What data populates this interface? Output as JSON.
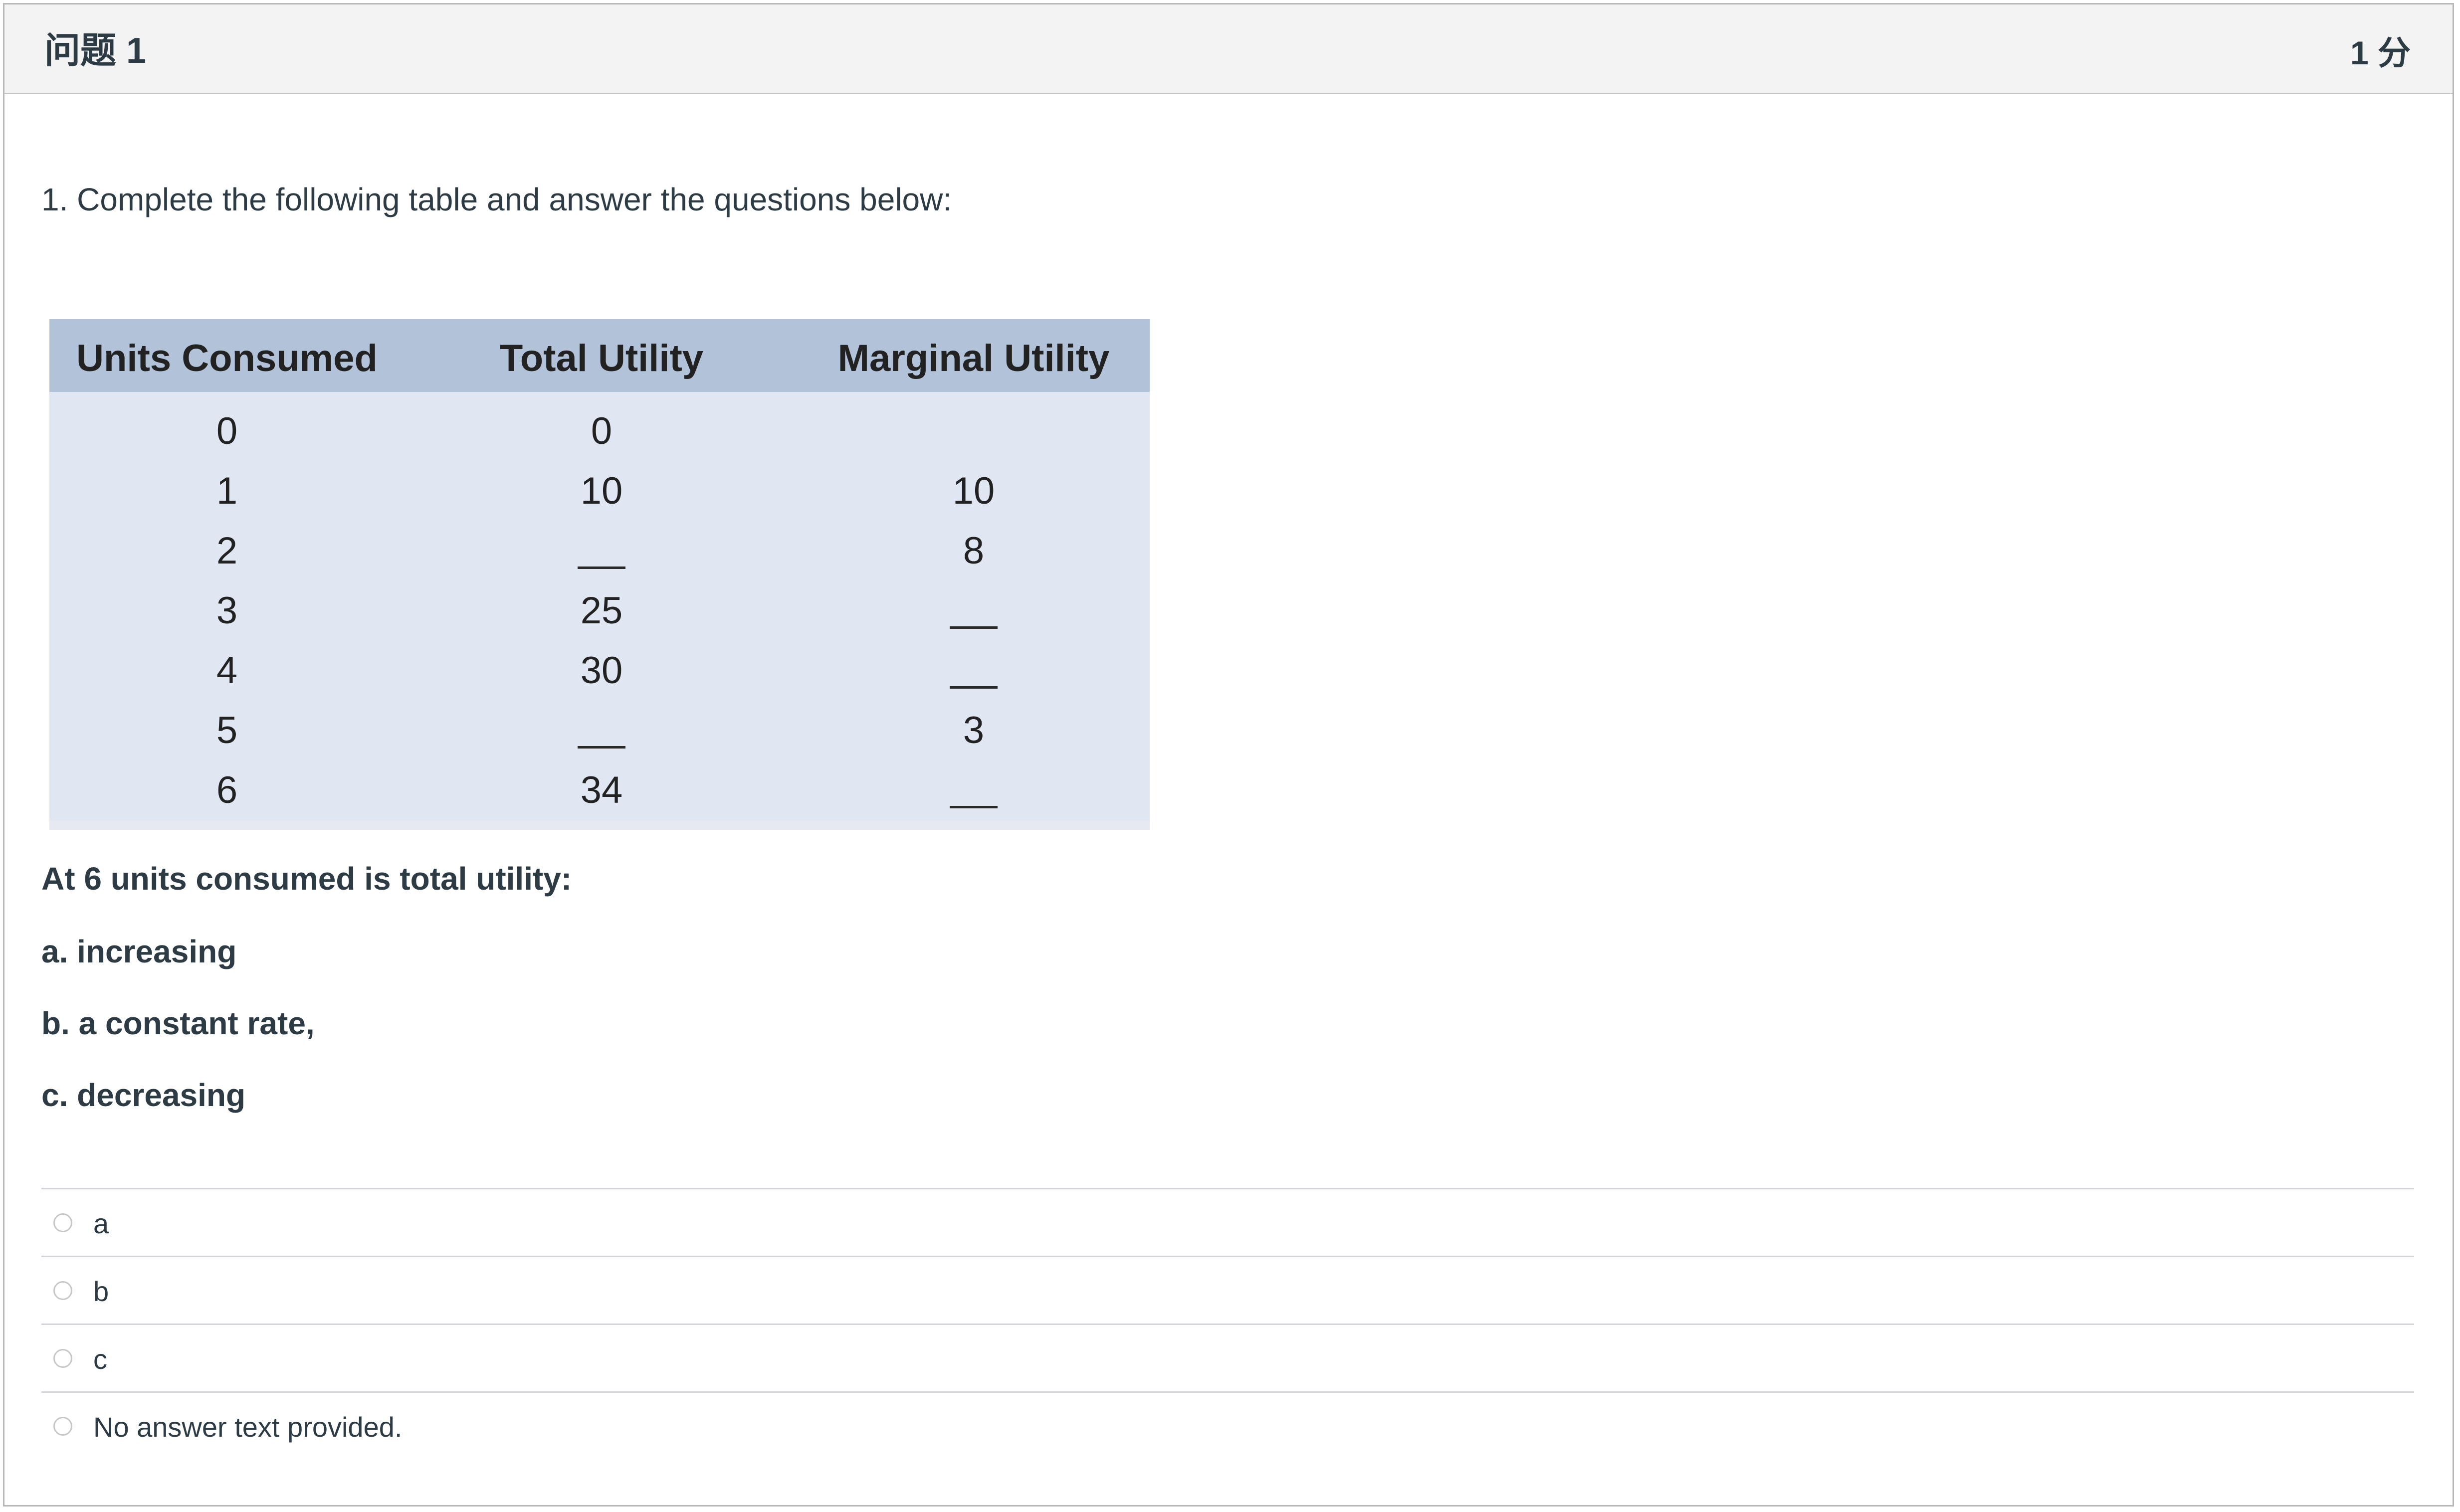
{
  "question": {
    "title": "问题 1",
    "points": "1 分",
    "prompt": "1. Complete the following table and answer the questions below:"
  },
  "utility_table": {
    "headers": [
      "Units Consumed",
      "Total Utility",
      "Marginal Utility"
    ],
    "rows": [
      {
        "units": "0",
        "total": "0",
        "marginal": ""
      },
      {
        "units": "1",
        "total": "10",
        "marginal": "10"
      },
      {
        "units": "2",
        "total": "__",
        "marginal": "8"
      },
      {
        "units": "3",
        "total": "25",
        "marginal": "__"
      },
      {
        "units": "4",
        "total": "30",
        "marginal": "__"
      },
      {
        "units": "5",
        "total": "__",
        "marginal": "3"
      },
      {
        "units": "6",
        "total": "34",
        "marginal": "__"
      }
    ]
  },
  "stem": {
    "question": "At 6 units consumed is total utility:",
    "option_a": "a. increasing",
    "option_b": "b.  a constant rate,",
    "option_c": "c. decreasing"
  },
  "answers": [
    {
      "label": "a",
      "selected": false
    },
    {
      "label": "b",
      "selected": false
    },
    {
      "label": "c",
      "selected": false
    },
    {
      "label": "No answer text provided.",
      "selected": false
    }
  ]
}
